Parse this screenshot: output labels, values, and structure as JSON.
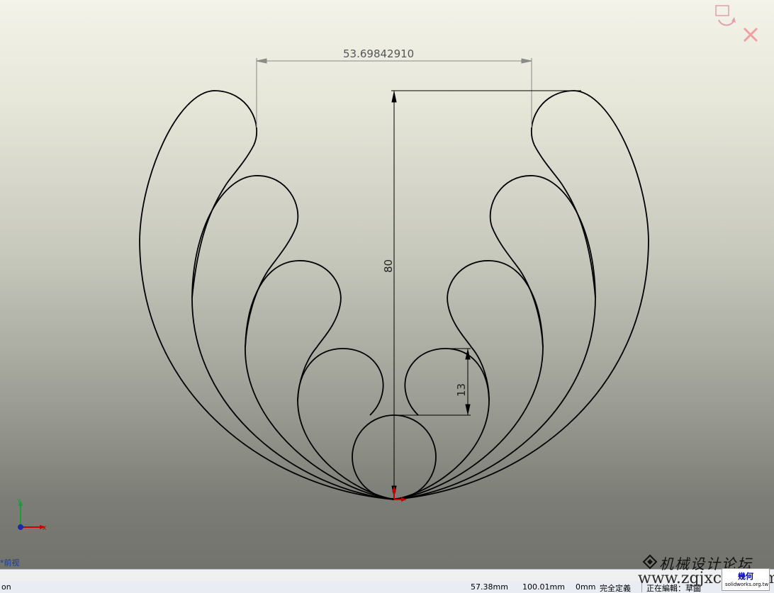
{
  "sketch": {
    "dimensions": {
      "horizontal": "53.69842910",
      "vertical": "80",
      "small": "13"
    }
  },
  "viewport": {
    "view_label": "*前视"
  },
  "statusbar": {
    "left_text": "on",
    "x_coord": "57.38mm",
    "y_coord": "100.01mm",
    "z_coord": "0mm",
    "state": "完全定義",
    "editing": "正在編輯：草圖"
  },
  "watermark": {
    "title": "机械设计论坛",
    "url": "www.zgjxcad.com",
    "badge_title": "幾何",
    "badge_url": "solidworks.org.tw"
  },
  "colors": {
    "curve": "#000000",
    "dimension": "#8a8a8a",
    "origin_red": "#cc0000",
    "axis_blue": "#1a2aa8",
    "axis_green": "#1f9a3a"
  }
}
